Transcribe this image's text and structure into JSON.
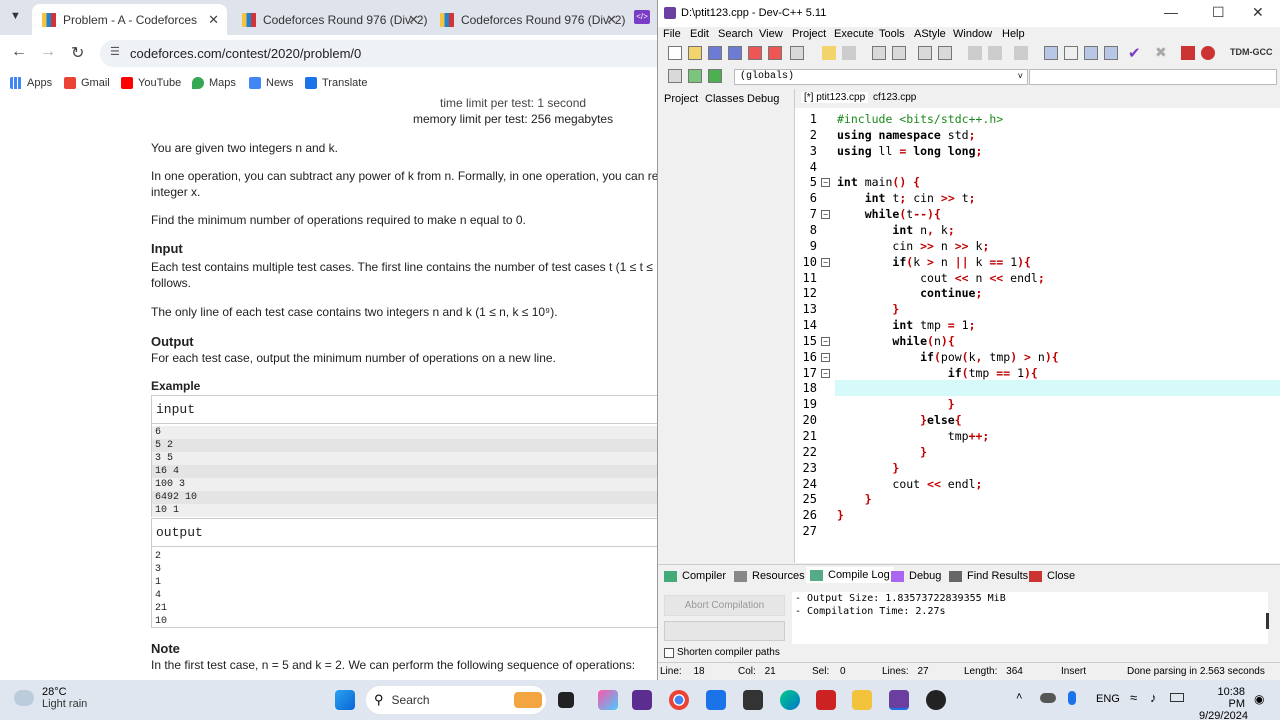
{
  "browser": {
    "tabs": [
      {
        "label": "Problem - A - Codeforces",
        "active": true
      },
      {
        "label": "Codeforces Round 976 (Div. 2)",
        "active": false
      },
      {
        "label": "Codeforces Round 976 (Div. 2)",
        "active": false
      }
    ],
    "url": "codeforces.com/contest/2020/problem/0",
    "bookmarks": [
      "Apps",
      "Gmail",
      "YouTube",
      "Maps",
      "News",
      "Translate"
    ]
  },
  "problem": {
    "time_limit": "time limit per test: 1 second",
    "memory_limit": "memory limit per test: 256 megabytes",
    "para1": "You are given two integers n and k.",
    "para2a": "In one operation, you can subtract any power of k from n. Formally, in one operation, you can repl",
    "para2b": "integer x.",
    "para3": "Find the minimum number of operations required to make n equal to 0.",
    "input_heading": "Input",
    "input_text1": "Each test contains multiple test cases. The first line contains the number of test cases t (1 ≤ t ≤",
    "input_text2": "follows.",
    "input_text3": "The only line of each test case contains two integers n and k (1 ≤ n, k ≤ 10⁹).",
    "output_heading": "Output",
    "output_text": "For each test case, output the minimum number of operations on a new line.",
    "example_heading": "Example",
    "input_label": "input",
    "input_lines": [
      "6",
      "5 2",
      "3 5",
      "16 4",
      "100 3",
      "6492 10",
      "10 1"
    ],
    "output_label": "output",
    "output_lines": [
      "2",
      "3",
      "1",
      "4",
      "21",
      "10"
    ],
    "note_heading": "Note",
    "note_text": "In the first test case, n = 5 and k = 2. We can perform the following sequence of operations:"
  },
  "ide": {
    "title": "D:\\ptit123.cpp - Dev-C++ 5.11",
    "menus": [
      "File",
      "Edit",
      "Search",
      "View",
      "Project",
      "Execute",
      "Tools",
      "AStyle",
      "Window",
      "Help"
    ],
    "compiler_label": "TDM-GCC",
    "globals": "(globals)",
    "left_tabs": [
      "Project",
      "Classes",
      "Debug"
    ],
    "file_tabs": [
      "[*] ptit123.cpp",
      "cf123.cpp"
    ],
    "bottom_tabs": [
      "Compiler",
      "Resources",
      "Compile Log",
      "Debug",
      "Find Results",
      "Close"
    ],
    "abort_label": "Abort Compilation",
    "shorten_label": "Shorten compiler paths",
    "log_lines": [
      "- Output Size: 1.83573722839355 MiB",
      "- Compilation Time: 2.27s"
    ],
    "status": {
      "line_label": "Line:",
      "line": "18",
      "col_label": "Col:",
      "col": "21",
      "sel_label": "Sel:",
      "sel": "0",
      "lines_label": "Lines:",
      "lines": "27",
      "length_label": "Length:",
      "length": "364",
      "mode": "Insert",
      "parse": "Done parsing in 2.563 seconds"
    }
  },
  "taskbar": {
    "weather_temp": "28°C",
    "weather_desc": "Light rain",
    "search": "Search",
    "lang": "ENG",
    "time": "10:38 PM",
    "date": "9/29/2024"
  }
}
